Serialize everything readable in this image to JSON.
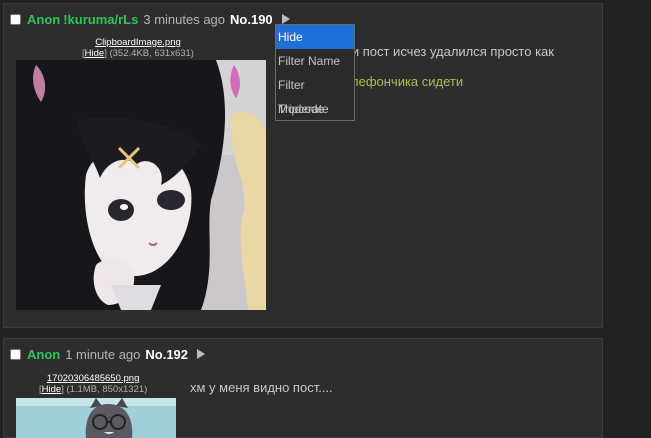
{
  "post1": {
    "name": "Anon",
    "tripcode": "!kuruma/rLs",
    "time": "3 minutes ago",
    "number": "No.190",
    "file_name": "ClipboardImage.png",
    "file_hide": "Hide",
    "file_meta": "(352.4KB, 631x631)",
    "message_line1": "е и пост исчез удалился просто как",
    "message_line2": "лефончика сидети",
    "colors": {
      "greentext": "#a7c44d"
    }
  },
  "dropdown": {
    "items": [
      "Hide",
      "Filter Name",
      "Filter Tripcode",
      "Moderate"
    ],
    "active_index": 0
  },
  "post2": {
    "name": "Anon",
    "time": "1 minute ago",
    "number": "No.192",
    "file_name": "17020306485650.png",
    "file_hide": "Hide",
    "file_meta": "(1.1MB, 850x1321)",
    "message": "хм у меня видно пост...."
  },
  "colors": {
    "background": "#222222",
    "post_background": "#2d2d2d",
    "name": "#2fc45b",
    "menu_highlight": "#1f6fd6"
  }
}
